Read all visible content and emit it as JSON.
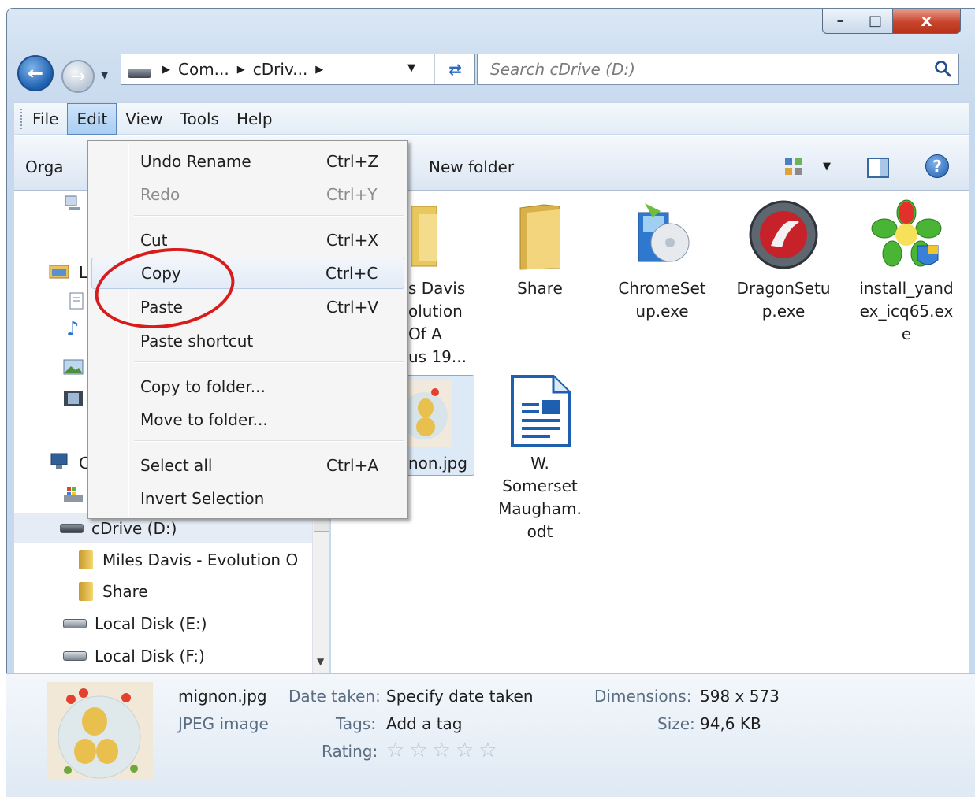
{
  "window": {
    "caption_min": "–",
    "caption_max": "□",
    "caption_close": "x"
  },
  "address": {
    "crumbs": [
      "Com...",
      "cDriv..."
    ],
    "search_placeholder": "Search cDrive (D:)"
  },
  "menubar": {
    "items": [
      "File",
      "Edit",
      "View",
      "Tools",
      "Help"
    ],
    "active": "Edit"
  },
  "toolbar": {
    "organize": "Orga",
    "new_folder": "New folder"
  },
  "edit_menu": {
    "items": [
      {
        "label": "Undo Rename",
        "shortcut": "Ctrl+Z"
      },
      {
        "label": "Redo",
        "shortcut": "Ctrl+Y",
        "disabled": true
      },
      {
        "label": "Cut",
        "shortcut": "Ctrl+X"
      },
      {
        "label": "Copy",
        "shortcut": "Ctrl+C",
        "hover": true
      },
      {
        "label": "Paste",
        "shortcut": "Ctrl+V"
      },
      {
        "label": "Paste shortcut",
        "shortcut": ""
      },
      {
        "label": "Copy to folder...",
        "shortcut": ""
      },
      {
        "label": "Move to folder...",
        "shortcut": ""
      },
      {
        "label": "Select all",
        "shortcut": "Ctrl+A"
      },
      {
        "label": "Invert Selection",
        "shortcut": ""
      }
    ]
  },
  "nav_tree": {
    "partial_items": [
      "L",
      "C"
    ],
    "items": [
      {
        "label": "cDrive (D:)",
        "type": "drive",
        "selected": true
      },
      {
        "label": "Miles Davis - Evolution O",
        "type": "folder"
      },
      {
        "label": "Share",
        "type": "folder"
      },
      {
        "label": "Local Disk (E:)",
        "type": "disk"
      },
      {
        "label": "Local Disk (F:)",
        "type": "disk"
      }
    ]
  },
  "files": [
    {
      "name_lines": [
        "s Davis",
        "olution",
        "Of A",
        "us 19..."
      ],
      "type": "folder"
    },
    {
      "name_lines": [
        "Share"
      ],
      "type": "folder"
    },
    {
      "name_lines": [
        "ChromeSet",
        "up.exe"
      ],
      "type": "installer"
    },
    {
      "name_lines": [
        "DragonSetu",
        "p.exe"
      ],
      "type": "dragon"
    },
    {
      "name_lines": [
        "install_yand",
        "ex_icq65.ex",
        "e"
      ],
      "type": "icq"
    },
    {
      "name_lines": [
        "non.jpg"
      ],
      "type": "image",
      "selected": true
    },
    {
      "name_lines": [
        "W.",
        "Somerset",
        "Maugham.",
        "odt"
      ],
      "type": "document"
    }
  ],
  "details": {
    "filename": "mignon.jpg",
    "filetype": "JPEG image",
    "date_taken_label": "Date taken:",
    "date_taken_value": "Specify date taken",
    "tags_label": "Tags:",
    "tags_value": "Add a tag",
    "rating_label": "Rating:",
    "rating": 0,
    "rating_max": 5,
    "dimensions_label": "Dimensions:",
    "dimensions_value": "598 x 573",
    "size_label": "Size:",
    "size_value": "94,6 KB"
  },
  "colors": {
    "annotation": "#d81c1c",
    "selection": "#dce9f7",
    "accent": "#1f5fb0"
  }
}
